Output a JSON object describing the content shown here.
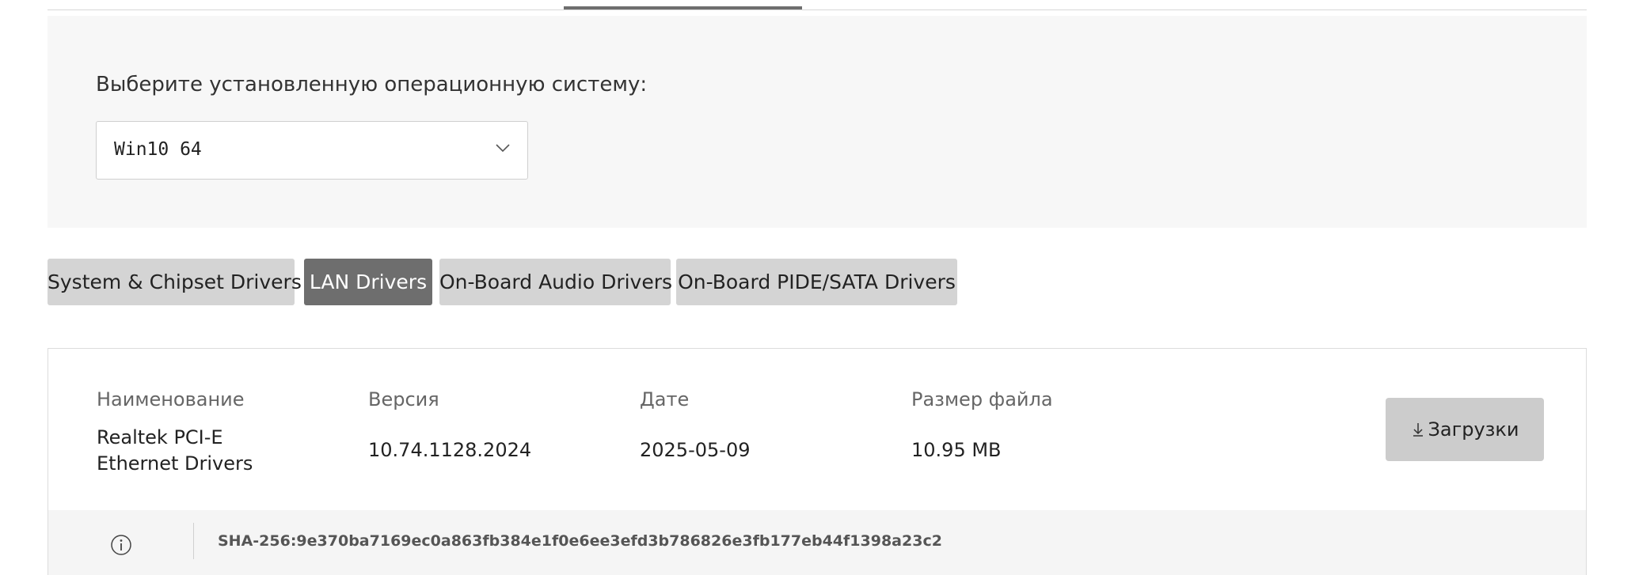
{
  "os_selector": {
    "label": "Выберите установленную операционную систему:",
    "selected": "Win10 64"
  },
  "tabs": [
    {
      "label": "System & Chipset Drivers",
      "active": false
    },
    {
      "label": "LAN Drivers",
      "active": true
    },
    {
      "label": "On-Board Audio Drivers",
      "active": false
    },
    {
      "label": "On-Board PIDE/SATA Drivers",
      "active": false
    }
  ],
  "driver_table": {
    "headers": {
      "name": "Наименование",
      "version": "Версия",
      "date": "Дате",
      "size": "Размер файла"
    },
    "row": {
      "name": "Realtek PCI-E Ethernet Drivers",
      "version": "10.74.1128.2024",
      "date": "2025-05-09",
      "size": "10.95 MB"
    },
    "download_label": "Загрузки",
    "hash": "SHA-256:9e370ba7169ec0a863fb384e1f0e6ee3efd3b786826e3fb177eb44f1398a23c2"
  },
  "icons": {
    "select_chevron": "chevron-down-icon",
    "download": "download-icon",
    "info": "info-icon"
  },
  "colors": {
    "active_tab": "#6e6e6e",
    "inactive_tab": "#d4d4d4",
    "panel_bg": "#f7f7f7",
    "download_button": "#cccccc"
  }
}
